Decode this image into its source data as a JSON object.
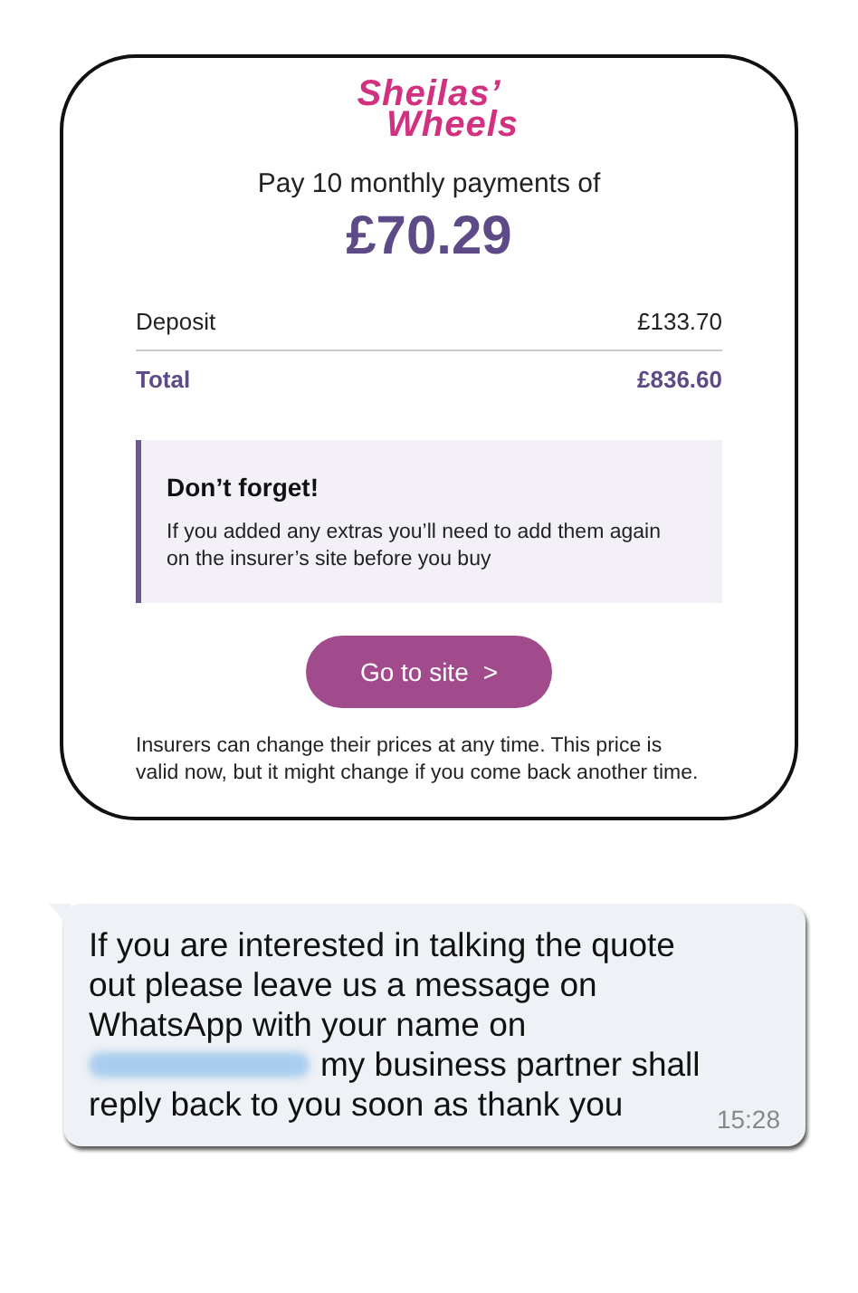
{
  "quote_card": {
    "logo": [
      "Sheilas’",
      "Wheels"
    ],
    "headline": "Pay 10 monthly payments of",
    "monthly_price": "£70.29",
    "rows": [
      {
        "kind": "plain",
        "label": "Deposit",
        "value": "£133.70"
      },
      {
        "kind": "total",
        "label": "Total",
        "value": "£836.60"
      }
    ],
    "notice": {
      "title": "Don’t forget!",
      "body": "If you added any extras you’ll need to add them again on the insurer’s site before you buy"
    },
    "button": {
      "label": "Go to site",
      "icon": ">"
    },
    "disclaimer": "Insurers can change their prices at any time. This price is valid now, but it might change if you come back another time."
  },
  "message": {
    "lines": [
      {
        "text": "If you are interested in talking the quote",
        "redacted_number": false
      },
      {
        "text": "out please leave us a message on",
        "redacted_number": false
      },
      {
        "text": "WhatsApp with your name on",
        "redacted_number": false
      },
      {
        "text": "my business partner shall",
        "redacted_number": true
      },
      {
        "text": "reply back to you soon as thank you",
        "redacted_number": false
      }
    ],
    "time": "15:28"
  }
}
